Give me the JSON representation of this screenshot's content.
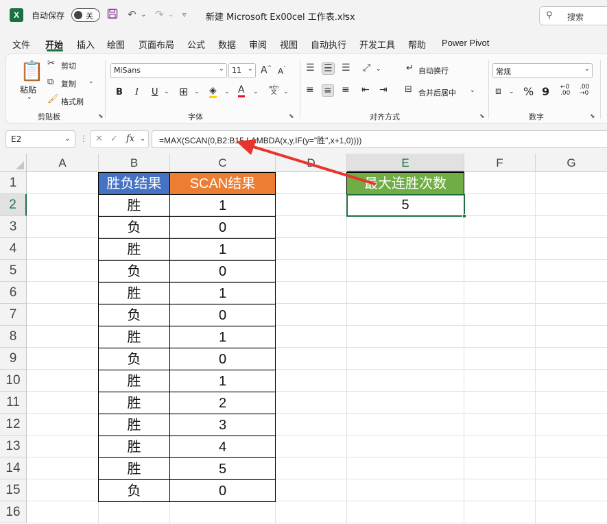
{
  "titlebar": {
    "logo": "X",
    "autosave_label": "自动保存",
    "toggle_state": "关",
    "doc_title": "新建 Microsoft Ex00cel 工作表.xlsx",
    "search_placeholder": "搜索"
  },
  "menu": {
    "tabs": [
      "文件",
      "开始",
      "插入",
      "绘图",
      "页面布局",
      "公式",
      "数据",
      "审阅",
      "视图",
      "自动执行",
      "开发工具",
      "帮助",
      "Power Pivot"
    ],
    "active": "开始"
  },
  "ribbon": {
    "clipboard": {
      "paste": "粘贴",
      "cut": "剪切",
      "copy": "复制",
      "format_painter": "格式刷",
      "label": "剪贴板"
    },
    "font": {
      "name": "MiSans",
      "size": "11",
      "bold": "B",
      "italic": "I",
      "underline": "U",
      "label": "字体",
      "phonetic": "wén",
      "phonetic2": "文"
    },
    "alignment": {
      "wrap": "自动换行",
      "merge": "合并后居中",
      "label": "对齐方式"
    },
    "number": {
      "format": "常规",
      "percent": "%",
      "comma": "9",
      "label": "数字"
    }
  },
  "formula_bar": {
    "name_box": "E2",
    "dots": "⋮",
    "fx": "fx",
    "formula": "=MAX(SCAN(0,B2:B15,LAMBDA(x,y,IF(y=\"胜\",x+1,0))))"
  },
  "grid": {
    "columns": [
      "A",
      "B",
      "C",
      "D",
      "E",
      "F",
      "G"
    ],
    "rows": [
      "1",
      "2",
      "3",
      "4",
      "5",
      "6",
      "7",
      "8",
      "9",
      "10",
      "11",
      "12",
      "13",
      "14",
      "15",
      "16"
    ],
    "selected_column": "E",
    "selected_row": "2",
    "table": {
      "headers": [
        "胜负结果",
        "SCAN结果"
      ],
      "rows": [
        [
          "胜",
          "1"
        ],
        [
          "负",
          "0"
        ],
        [
          "胜",
          "1"
        ],
        [
          "负",
          "0"
        ],
        [
          "胜",
          "1"
        ],
        [
          "负",
          "0"
        ],
        [
          "胜",
          "1"
        ],
        [
          "负",
          "0"
        ],
        [
          "胜",
          "1"
        ],
        [
          "胜",
          "2"
        ],
        [
          "胜",
          "3"
        ],
        [
          "胜",
          "4"
        ],
        [
          "胜",
          "5"
        ],
        [
          "负",
          "0"
        ]
      ]
    },
    "result": {
      "header": "最大连胜次数",
      "value": "5"
    }
  },
  "colors": {
    "excel_green": "#1d6f42",
    "header_blue": "#4472c4",
    "header_orange": "#ed7d31",
    "header_green": "#70ad47",
    "arrow_red": "#e8352b"
  }
}
